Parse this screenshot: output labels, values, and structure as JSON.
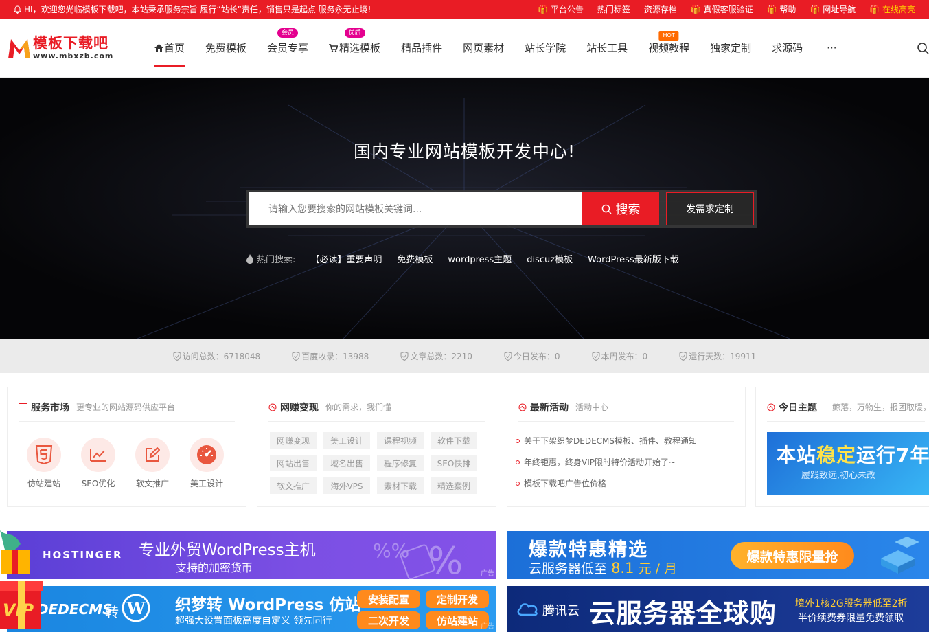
{
  "topbar": {
    "welcome": "HI，欢迎您光临模板下载吧，本站秉承服务宗旨 履行“站长”责任，销售只是起点 服务永无止境!",
    "links": [
      {
        "label": "平台公告"
      },
      {
        "label": "热门标签"
      },
      {
        "label": "资源存档"
      },
      {
        "label": "真假客服验证"
      },
      {
        "label": "帮助"
      },
      {
        "label": "网址导航"
      },
      {
        "label": "在线高亮"
      }
    ]
  },
  "logo": {
    "cn": "模板下载吧",
    "en": "www.mbxzb.com"
  },
  "nav": [
    {
      "label": "首页",
      "active": true
    },
    {
      "label": "免费模板"
    },
    {
      "label": "会员专享",
      "badge": "会员"
    },
    {
      "label": "精选模板",
      "badge": "优质"
    },
    {
      "label": "精品插件"
    },
    {
      "label": "网页素材"
    },
    {
      "label": "站长学院"
    },
    {
      "label": "站长工具"
    },
    {
      "label": "视频教程",
      "badge": "HOT"
    },
    {
      "label": "独家定制"
    },
    {
      "label": "求源码"
    },
    {
      "label": "···"
    }
  ],
  "hero": {
    "title": "国内专业网站模板开发中心!",
    "search_placeholder": "请输入您要搜索的网站模板关键词...",
    "search_button": "搜索",
    "custom_button": "发需求定制",
    "hot_label": "热门搜索:",
    "hot_tags": [
      "【必读】重要声明",
      "免费模板",
      "wordpress主题",
      "discuz模板",
      "WordPress最新版下载"
    ]
  },
  "stats": [
    {
      "label": "访问总数：6718048"
    },
    {
      "label": "百度收录：13988"
    },
    {
      "label": "文章总数：2210"
    },
    {
      "label": "今日发布：0"
    },
    {
      "label": "本周发布：0"
    },
    {
      "label": "运行天数：19911"
    }
  ],
  "cards": {
    "service": {
      "title": "服务市场",
      "sub": "更专业的网站源码供应平台",
      "items": [
        "仿站建站",
        "SEO优化",
        "软文推广",
        "美工设计"
      ]
    },
    "earn": {
      "title": "网赚变现",
      "sub": "你的需求，我们懂",
      "tags": [
        "网赚变现",
        "美工设计",
        "课程视频",
        "软件下载",
        "网站出售",
        "域名出售",
        "程序修复",
        "SEO快排",
        "软文推广",
        "海外VPS",
        "素材下载",
        "精选案例"
      ]
    },
    "activity": {
      "title": "最新活动",
      "sub": "活动中心",
      "items": [
        "关于下架织梦DEDECMS模板、插件、教程通知",
        "年终钜惠，终身VIP限时特价活动开始了~",
        "模板下载吧广告位价格"
      ]
    },
    "theme": {
      "title": "今日主题",
      "sub": "一鲸落，万物生，报团取暖，",
      "banner_main_a": "本站",
      "banner_main_b": "稳定",
      "banner_main_c": "运行7年",
      "banner_sub": "履践致远,初心未改"
    }
  },
  "ads": {
    "ad1": {
      "brand": "HOSTINGER",
      "line1": "专业外贸WordPress主机",
      "line2": "支持的加密货币",
      "tag": "广告"
    },
    "ad2": {
      "line1": "爆款特惠精选",
      "line2a": "云服务器低至",
      "price": "8.1",
      "line2b": "元 / 月",
      "button": "爆款特惠限量抢"
    },
    "ad3": {
      "brand": "DEDECMS",
      "mid": "转",
      "title": "织梦转 WordPress 仿站",
      "sub": "超强大设置面板高度自定义 领先同行",
      "buttons": [
        "安装配置",
        "定制开发",
        "二次开发",
        "仿站建站"
      ],
      "tag": "广告"
    },
    "ad4": {
      "brand": "腾讯云",
      "title": "云服务器全球购",
      "line1": "境外1核2G服务器低至2折",
      "line2": "半价续费券限量免费领取"
    }
  },
  "colors": {
    "brand": "#e91c25",
    "badge_pink": "#e4008f",
    "hot": "#ff6a00"
  }
}
